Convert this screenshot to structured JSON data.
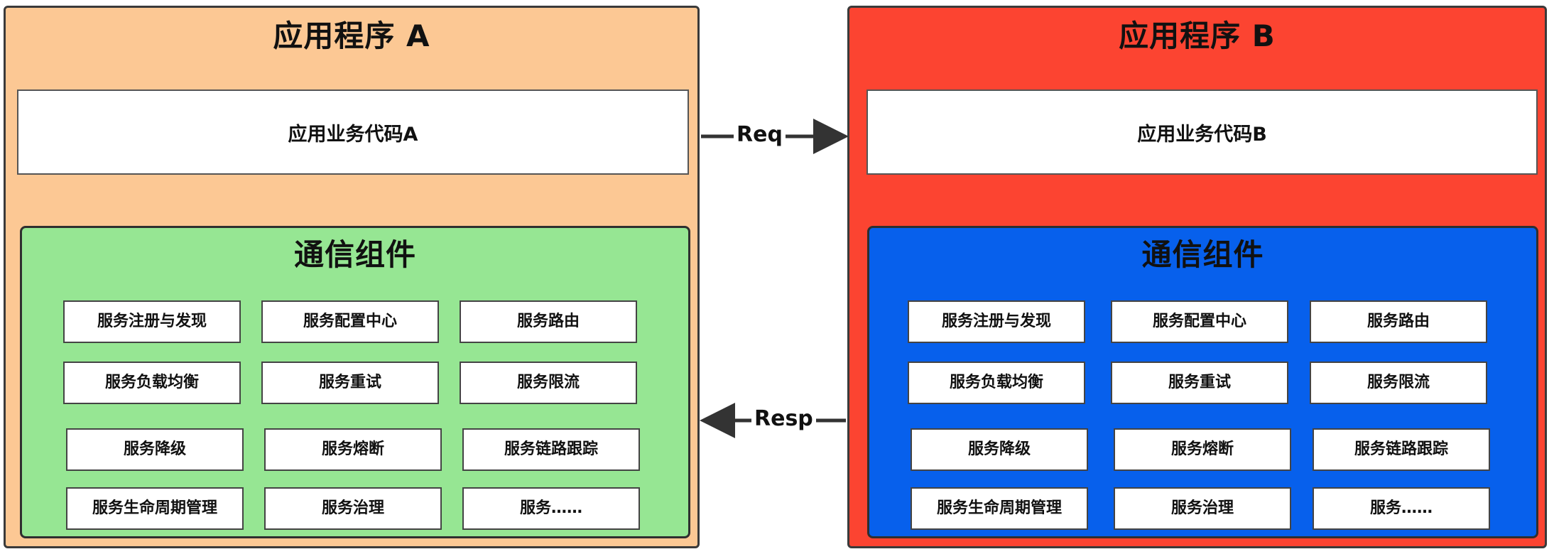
{
  "app_a": {
    "title": "应用程序 A",
    "business": "应用业务代码A",
    "comm_title": "通信组件",
    "services": [
      "服务注册与发现",
      "服务配置中心",
      "服务路由",
      "服务负载均衡",
      "服务重试",
      "服务限流",
      "服务降级",
      "服务熔断",
      "服务链路跟踪",
      "服务生命周期管理",
      "服务治理",
      "服务……"
    ]
  },
  "app_b": {
    "title": "应用程序 B",
    "business": "应用业务代码B",
    "comm_title": "通信组件",
    "services": [
      "服务注册与发现",
      "服务配置中心",
      "服务路由",
      "服务负载均衡",
      "服务重试",
      "服务限流",
      "服务降级",
      "服务熔断",
      "服务链路跟踪",
      "服务生命周期管理",
      "服务治理",
      "服务……"
    ]
  },
  "connectors": {
    "request": "Req",
    "response": "Resp"
  },
  "colors": {
    "app_a_bg": "#fcc894",
    "app_b_bg": "#fc4431",
    "comm_a_bg": "#96e693",
    "comm_b_bg": "#0760ec"
  }
}
